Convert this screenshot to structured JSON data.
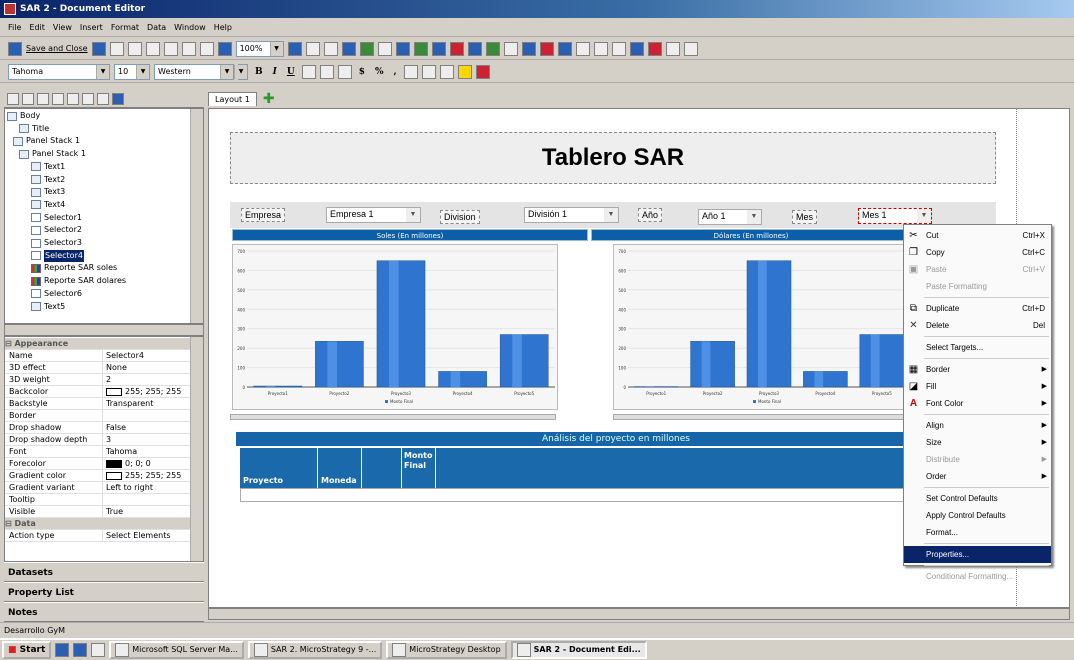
{
  "window": {
    "title": "SAR 2 - Document Editor"
  },
  "menu": [
    "File",
    "Edit",
    "View",
    "Insert",
    "Format",
    "Data",
    "Window",
    "Help"
  ],
  "toolbar": {
    "save_close": "Save and Close",
    "zoom": "100%"
  },
  "format_bar": {
    "font": "Tahoma",
    "size": "10",
    "script": "Western",
    "bold": "B",
    "italic": "I",
    "underline": "U",
    "currency": "$",
    "percent": "%",
    "comma": ","
  },
  "tree": [
    {
      "label": "Body",
      "indent": 0,
      "icon": "panel"
    },
    {
      "label": "Title",
      "indent": 2,
      "icon": "text"
    },
    {
      "label": "Panel Stack 1",
      "indent": 1,
      "icon": "panel"
    },
    {
      "label": "Panel Stack 1",
      "indent": 2,
      "icon": "panel"
    },
    {
      "label": "Text1",
      "indent": 4,
      "icon": "text"
    },
    {
      "label": "Text2",
      "indent": 4,
      "icon": "text"
    },
    {
      "label": "Text3",
      "indent": 4,
      "icon": "text"
    },
    {
      "label": "Text4",
      "indent": 4,
      "icon": "text"
    },
    {
      "label": "Selector1",
      "indent": 4,
      "icon": "selector"
    },
    {
      "label": "Selector2",
      "indent": 4,
      "icon": "selector"
    },
    {
      "label": "Selector3",
      "indent": 4,
      "icon": "selector"
    },
    {
      "label": "Selector4",
      "indent": 4,
      "icon": "selector",
      "selected": true
    },
    {
      "label": "Reporte SAR soles",
      "indent": 4,
      "icon": "graph"
    },
    {
      "label": "Reporte SAR dolares",
      "indent": 4,
      "icon": "graph"
    },
    {
      "label": "Selector6",
      "indent": 4,
      "icon": "selector"
    },
    {
      "label": "Text5",
      "indent": 4,
      "icon": "text"
    }
  ],
  "properties": [
    {
      "section": "Appearance"
    },
    {
      "k": "Name",
      "v": "Selector4"
    },
    {
      "k": "3D effect",
      "v": "None"
    },
    {
      "k": "3D weight",
      "v": "2"
    },
    {
      "k": "Backcolor",
      "v": "255; 255; 255",
      "swatch": "#ffffff"
    },
    {
      "k": "Backstyle",
      "v": "Transparent"
    },
    {
      "k": "Border",
      "v": ""
    },
    {
      "k": "Drop shadow",
      "v": "False"
    },
    {
      "k": "Drop shadow depth",
      "v": "3"
    },
    {
      "k": "Font",
      "v": "Tahoma"
    },
    {
      "k": "Forecolor",
      "v": "0; 0; 0",
      "swatch": "#000000"
    },
    {
      "k": "Gradient color",
      "v": "255; 255; 255",
      "swatch": "#ffffff"
    },
    {
      "k": "Gradient variant",
      "v": "Left to right"
    },
    {
      "k": "Tooltip",
      "v": ""
    },
    {
      "k": "Visible",
      "v": "True"
    },
    {
      "section": "Data"
    },
    {
      "k": "Action type",
      "v": "Select Elements"
    }
  ],
  "panels": {
    "datasets": "Datasets",
    "property_list": "Property List",
    "notes": "Notes"
  },
  "layout_tab": "Layout 1",
  "document": {
    "title": "Tablero SAR",
    "filters": [
      {
        "label": "Empresa",
        "value": "Empresa 1"
      },
      {
        "label": "Division",
        "value": "División 1"
      },
      {
        "label": "Año",
        "value": "Año 1"
      },
      {
        "label": "Mes",
        "value": "Mes 1"
      }
    ],
    "chart_soles_title": "Soles (En millones)",
    "chart_dolares_title": "Dólares (En millones)",
    "table_title": "Análisis del proyecto en millones",
    "table_headers": [
      "Proyecto",
      "Moneda",
      "",
      "Monto Final"
    ]
  },
  "chart_data": [
    {
      "type": "bar",
      "title": "Soles (En millones)",
      "categories": [
        "Proyecto1",
        "Proyecto2",
        "Proyecto3",
        "Proyecto4",
        "Proyecto5"
      ],
      "series": [
        {
          "name": "Monto Final",
          "values": [
            5,
            235,
            650,
            80,
            270
          ]
        }
      ],
      "ylim": [
        0,
        700
      ],
      "yticks": [
        0,
        100,
        200,
        300,
        400,
        500,
        600,
        700
      ]
    },
    {
      "type": "bar",
      "title": "Dólares (En millones)",
      "categories": [
        "Proyecto1",
        "Proyecto2",
        "Proyecto3",
        "Proyecto4",
        "Proyecto5"
      ],
      "series": [
        {
          "name": "Monto Final",
          "values": [
            2,
            235,
            650,
            80,
            270
          ]
        }
      ],
      "ylim": [
        0,
        700
      ],
      "yticks": [
        0,
        100,
        200,
        300,
        400,
        500,
        600,
        700
      ]
    }
  ],
  "context_menu": [
    {
      "label": "Cut",
      "shortcut": "Ctrl+X",
      "icon": "cut-icon"
    },
    {
      "label": "Copy",
      "shortcut": "Ctrl+C",
      "icon": "copy-icon"
    },
    {
      "label": "Paste",
      "shortcut": "Ctrl+V",
      "icon": "paste-icon",
      "disabled": true
    },
    {
      "label": "Paste Formatting",
      "disabled": true
    },
    {
      "sep": true
    },
    {
      "label": "Duplicate",
      "shortcut": "Ctrl+D",
      "icon": "duplicate-icon"
    },
    {
      "label": "Delete",
      "shortcut": "Del",
      "icon": "delete-icon"
    },
    {
      "sep": true
    },
    {
      "label": "Select Targets..."
    },
    {
      "sep": true
    },
    {
      "label": "Border",
      "submenu": true,
      "icon": "border-icon"
    },
    {
      "label": "Fill",
      "submenu": true,
      "icon": "fill-icon"
    },
    {
      "label": "Font Color",
      "submenu": true,
      "icon": "font-color-icon"
    },
    {
      "sep": true
    },
    {
      "label": "Align",
      "submenu": true
    },
    {
      "label": "Size",
      "submenu": true
    },
    {
      "label": "Distribute",
      "submenu": true,
      "disabled": true
    },
    {
      "label": "Order",
      "submenu": true
    },
    {
      "sep": true
    },
    {
      "label": "Set Control Defaults"
    },
    {
      "label": "Apply Control Defaults"
    },
    {
      "label": "Format..."
    },
    {
      "sep": true
    },
    {
      "label": "Properties...",
      "highlighted": true
    },
    {
      "sep": true
    },
    {
      "label": "Conditional Formatting...",
      "disabled": true
    }
  ],
  "status": "Desarrollo GyM",
  "taskbar": {
    "start": "Start",
    "tasks": [
      {
        "label": "Microsoft SQL Server Ma..."
      },
      {
        "label": "SAR 2. MicroStrategy 9 -..."
      },
      {
        "label": "MicroStrategy Desktop"
      },
      {
        "label": "SAR 2 - Document Edi...",
        "active": true
      }
    ]
  }
}
